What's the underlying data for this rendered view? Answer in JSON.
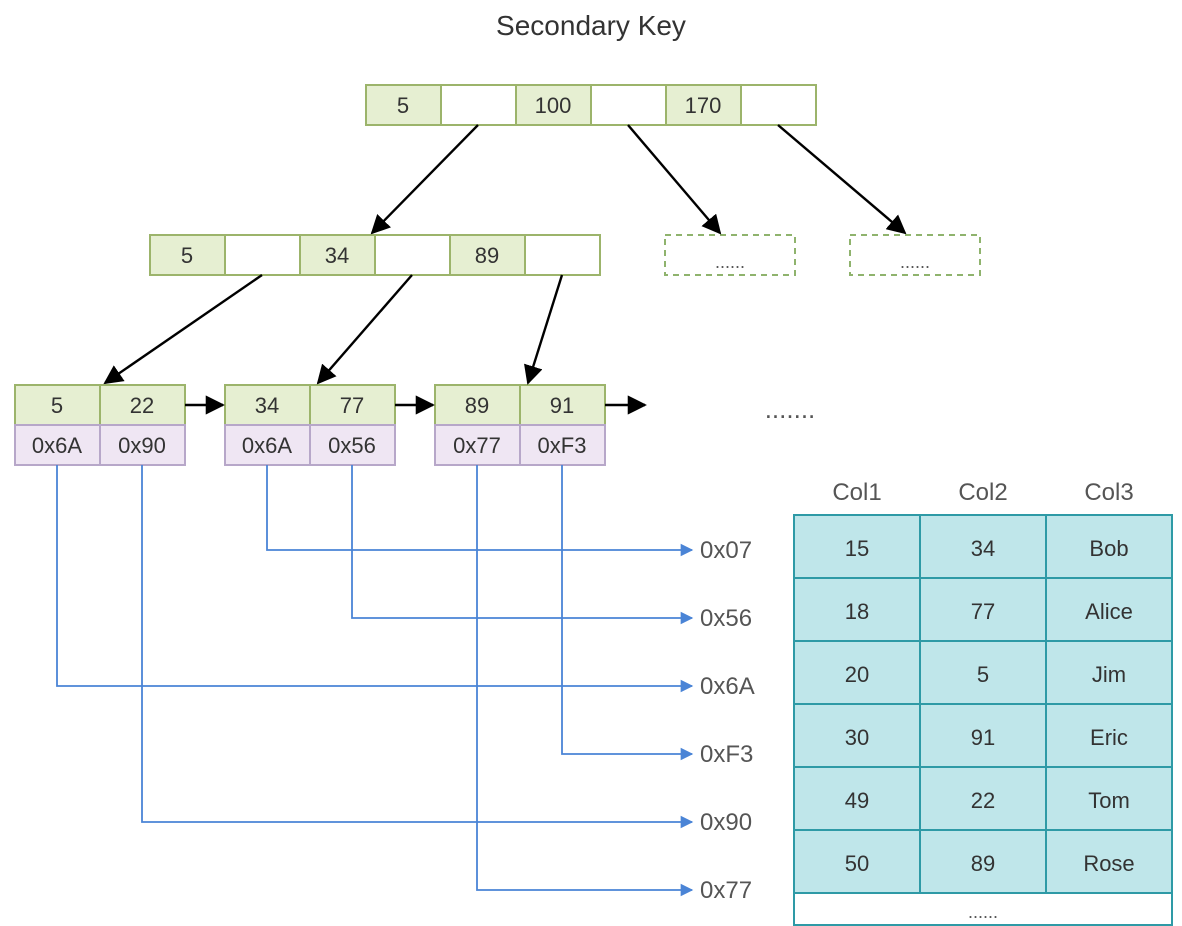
{
  "title": "Secondary Key",
  "root_node": {
    "keys": [
      "5",
      "100",
      "170"
    ]
  },
  "internal_node": {
    "keys": [
      "5",
      "34",
      "89"
    ]
  },
  "leaves": [
    {
      "keys": [
        "5",
        "22"
      ],
      "vals": [
        "0x6A",
        "0x90"
      ]
    },
    {
      "keys": [
        "34",
        "77"
      ],
      "vals": [
        "0x6A",
        "0x56"
      ]
    },
    {
      "keys": [
        "89",
        "91"
      ],
      "vals": [
        "0x77",
        "0xF3"
      ]
    }
  ],
  "ellipsis": ".......",
  "ghost_ellipsis": "......",
  "addresses": [
    "0x07",
    "0x56",
    "0x6A",
    "0xF3",
    "0x90",
    "0x77"
  ],
  "table": {
    "headers": [
      "Col1",
      "Col2",
      "Col3"
    ],
    "rows": [
      [
        "15",
        "34",
        "Bob"
      ],
      [
        "18",
        "77",
        "Alice"
      ],
      [
        "20",
        "5",
        "Jim"
      ],
      [
        "30",
        "91",
        "Eric"
      ],
      [
        "49",
        "22",
        "Tom"
      ],
      [
        "50",
        "89",
        "Rose"
      ]
    ],
    "more": "......"
  }
}
